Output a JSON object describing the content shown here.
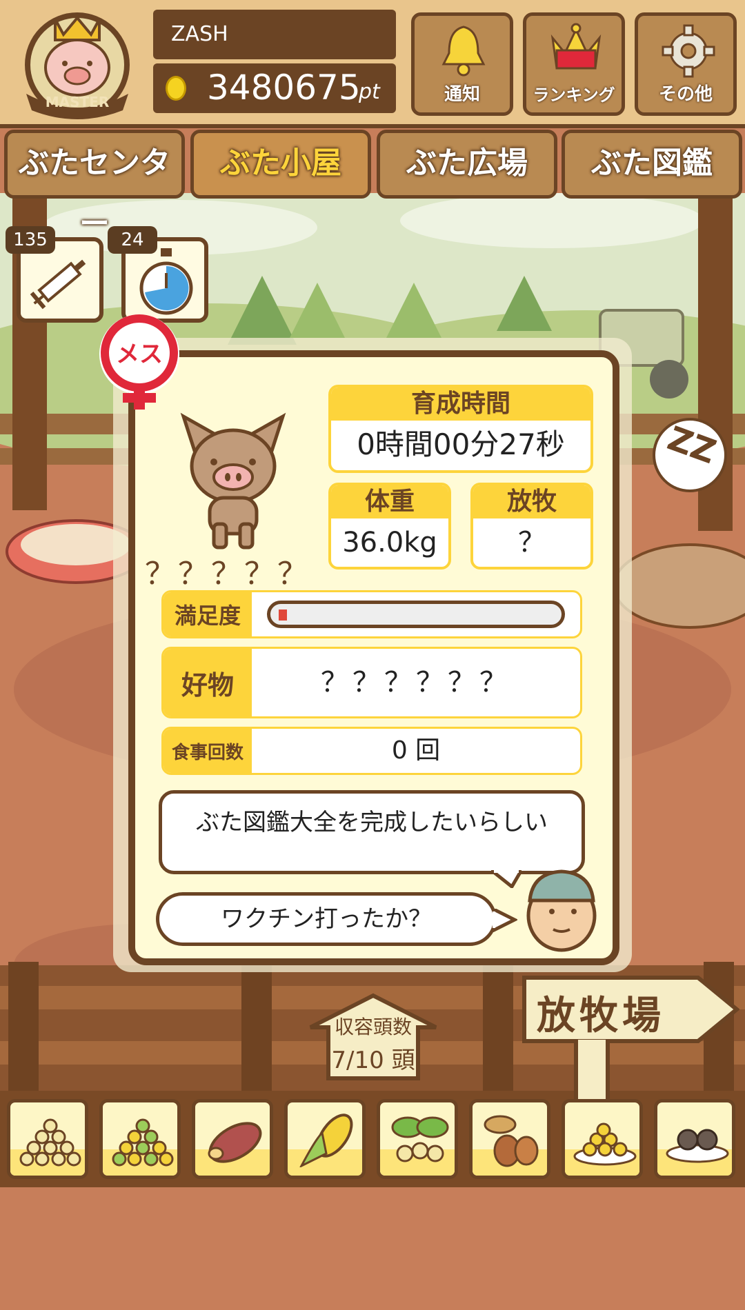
{
  "header": {
    "badge_label": "MASTER",
    "username": "ZASH",
    "points": "3480675",
    "points_unit": "pt",
    "buttons": [
      {
        "label": "通知",
        "icon": "bell-icon"
      },
      {
        "label": "ランキング",
        "icon": "crown-icon"
      },
      {
        "label": "その他",
        "icon": "gear-icon"
      }
    ]
  },
  "tabs": [
    {
      "label": "ぶたセンター"
    },
    {
      "label": "ぶた小屋",
      "active": true
    },
    {
      "label": "ぶた広場"
    },
    {
      "label": "ぶた図鑑"
    }
  ],
  "items": {
    "syringe_count": "135",
    "timer_count": "24"
  },
  "pig": {
    "sex": "メス",
    "name": "？？？？？",
    "raising_time_label": "育成時間",
    "raising_time": "0時間00分27秒",
    "weight_label": "体重",
    "weight": "36.0kg",
    "grazing_label": "放牧",
    "grazing": "？",
    "satisfaction_label": "満足度",
    "satisfaction": 0.03,
    "favorite_label": "好物",
    "favorite": "？？？？？？",
    "meals_label": "食事回数",
    "meals": "0 回",
    "thought": "ぶた図鑑大全を完成したいらしい",
    "farmer_says": "ワクチン打ったか？"
  },
  "pen": {
    "capacity_label": "収容頭数",
    "capacity": "7/10 頭",
    "pasture_sign": "放牧場"
  },
  "foods": [
    {
      "icon": "grain-pile-icon"
    },
    {
      "icon": "mixed-grain-icon"
    },
    {
      "icon": "sweet-potato-icon"
    },
    {
      "icon": "corn-icon"
    },
    {
      "icon": "leaf-beans-icon"
    },
    {
      "icon": "acorn-icon"
    },
    {
      "icon": "plate-beans-icon"
    },
    {
      "icon": "plate-truffle-icon"
    }
  ],
  "colors": {
    "wood_dark": "#6b4424",
    "wood": "#b98a52",
    "panel_bg": "#fffbd6",
    "accent_yellow": "#fdd43b",
    "female_red": "#e0283a",
    "ground": "#c77e5a"
  }
}
